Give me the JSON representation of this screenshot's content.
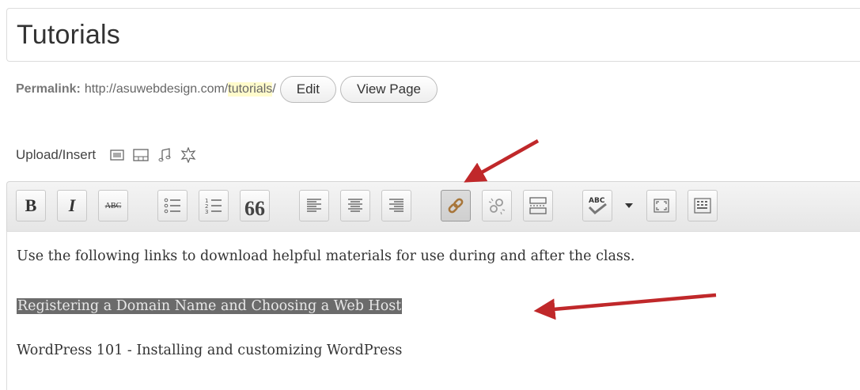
{
  "post": {
    "title": "Tutorials"
  },
  "permalink": {
    "label": "Permalink:",
    "base": "http://asuwebdesign.com/",
    "slug": "tutorials",
    "slash": "/",
    "edit_label": "Edit",
    "view_label": "View Page"
  },
  "upload": {
    "label": "Upload/Insert",
    "icons": [
      "add-image-icon",
      "add-video-icon",
      "add-audio-icon",
      "add-media-icon"
    ]
  },
  "toolbar": {
    "bold": "B",
    "italic": "I",
    "strikethrough": "ABC",
    "blockquote": "66",
    "spellcheck": "ABC",
    "buttons": [
      "bold",
      "italic",
      "strikethrough",
      "bulleted-list",
      "numbered-list",
      "blockquote",
      "align-left",
      "align-center",
      "align-right",
      "insert-link",
      "unlink",
      "insert-more",
      "spellcheck",
      "fullscreen",
      "kitchen-sink"
    ],
    "active": "insert-link"
  },
  "content": {
    "paragraph1": "Use the following links to download helpful materials for use during and after the class.",
    "paragraph2_selected": "Registering a Domain Name and Choosing a Web Host",
    "paragraph3": "WordPress 101 - Installing and customizing WordPress"
  },
  "colors": {
    "arrow": "#c0282a",
    "selection": "#6b6b6b",
    "slug_highlight": "#fffbcc"
  }
}
